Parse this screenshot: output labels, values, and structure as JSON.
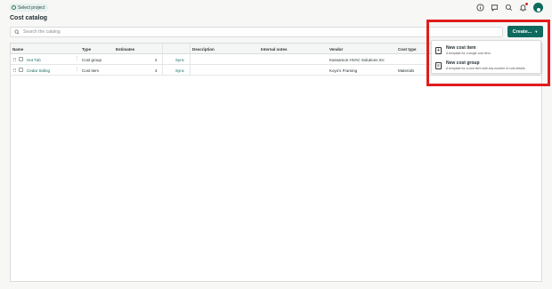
{
  "header": {
    "project_selector": "Select project",
    "icons": [
      "info-icon",
      "chat-icon",
      "search-icon",
      "notifications-icon",
      "avatar"
    ]
  },
  "page": {
    "title": "Cost catalog"
  },
  "search": {
    "placeholder": "Search the catalog",
    "value": ""
  },
  "create_button": {
    "label": "Create...",
    "icon": "chevron-down-icon"
  },
  "table": {
    "columns": [
      "Name",
      "Type",
      "Estimates",
      "Description",
      "Internal notes",
      "Vendor",
      "Cost type"
    ],
    "rows": [
      {
        "name": "Hot Tub",
        "type": "Cost group",
        "estimates": "2",
        "sync": "Sync",
        "description": "",
        "internal_notes": "",
        "vendor": "Kassamon HVAC Solutions Inc",
        "cost_type": ""
      },
      {
        "name": "Cedar Siding",
        "type": "Cost item",
        "estimates": "4",
        "sync": "Sync",
        "description": "",
        "internal_notes": "",
        "vendor": "Koyo's Framing",
        "cost_type": "Materials"
      }
    ]
  },
  "create_menu": {
    "items": [
      {
        "title": "New cost item",
        "desc": "A template for a single cost item."
      },
      {
        "title": "New cost group",
        "desc": "A template for a cost item with any number of cost details."
      }
    ]
  },
  "colors": {
    "accent": "#0f6a5e",
    "highlight": "#e11c1c",
    "link": "#0f6a5e"
  }
}
